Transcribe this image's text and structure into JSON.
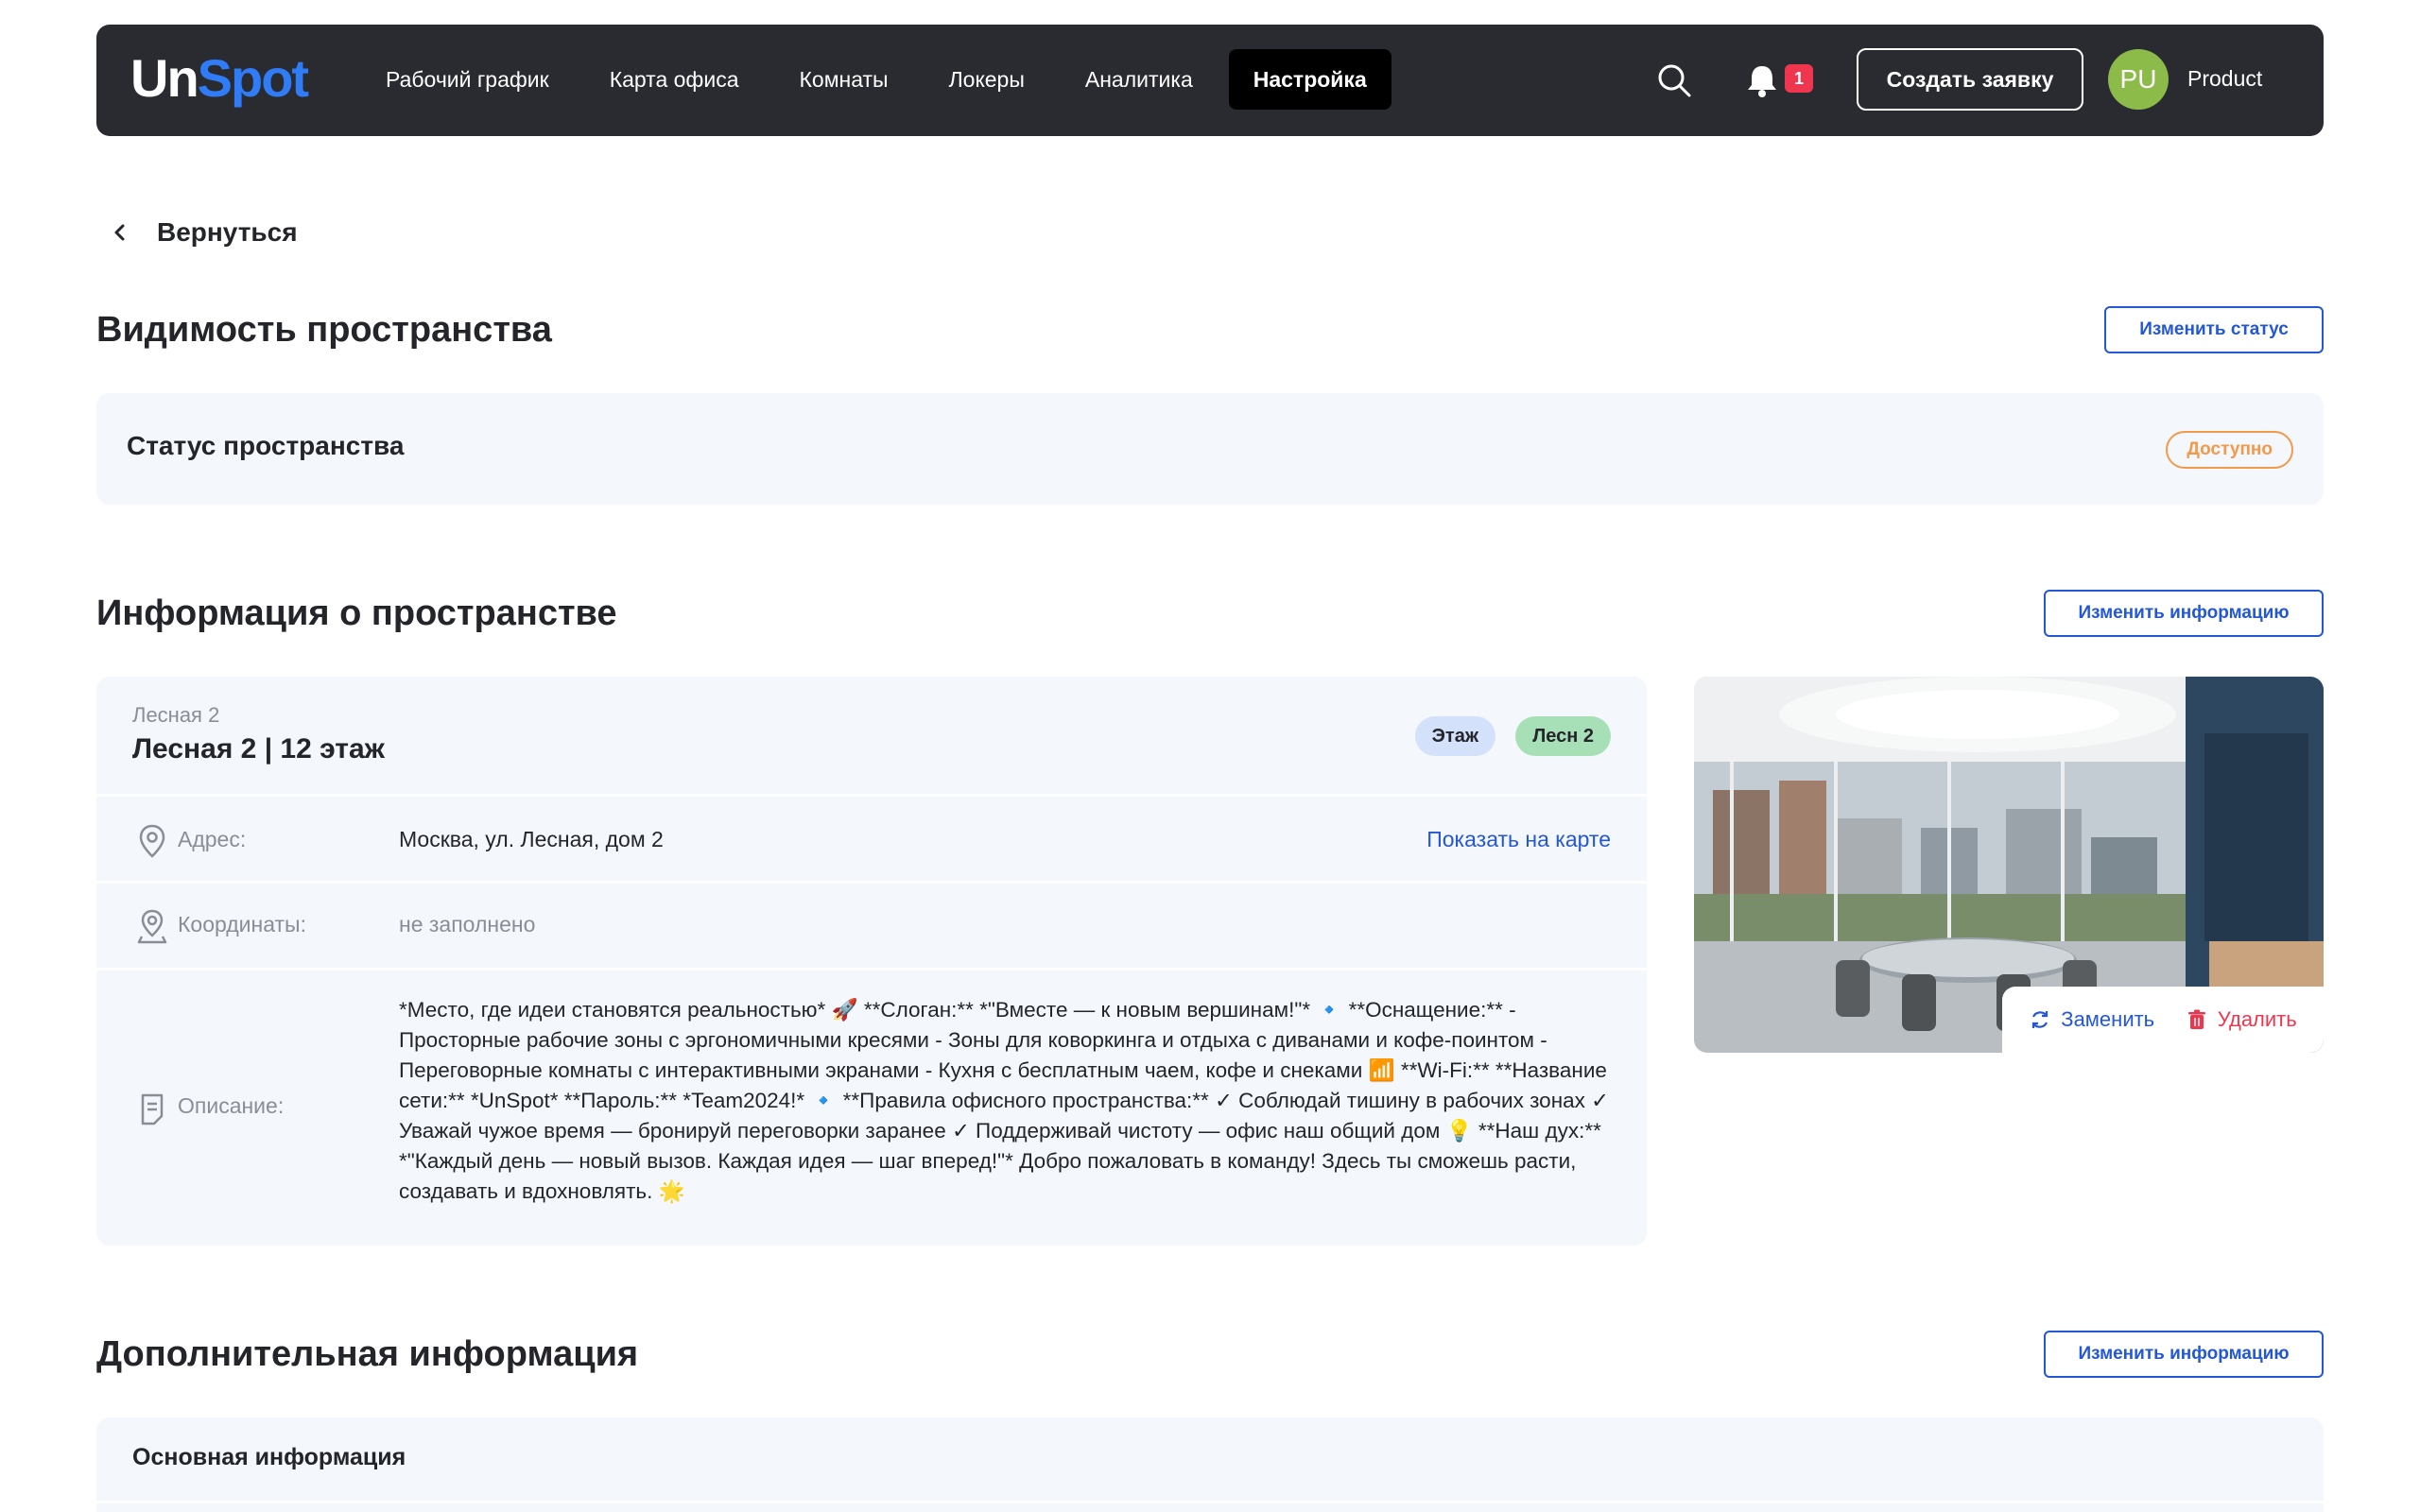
{
  "header": {
    "logo_un": "Un",
    "logo_spot": "Spot",
    "nav": [
      "Рабочий график",
      "Карта офиса",
      "Комнаты",
      "Локеры",
      "Аналитика",
      "Настройка"
    ],
    "active_nav": "Настройка",
    "notification_count": "1",
    "create_button": "Создать заявку",
    "avatar_initials": "PU",
    "user_name": "Product",
    "avatar_color": "#8dbb4a",
    "accent_color": "#2f7cf6"
  },
  "back": {
    "label": "Вернуться"
  },
  "visibility": {
    "title": "Видимость пространства",
    "change_button": "Изменить статус",
    "status_label": "Статус пространства",
    "status_value": "Доступно",
    "status_color": "#f39a4a"
  },
  "info": {
    "title": "Информация о пространстве",
    "change_button": "Изменить информацию",
    "building": "Лесная 2",
    "space_name": "Лесная 2 | 12 этаж",
    "tags": [
      "Этаж",
      "Лесн 2"
    ],
    "address_label": "Адрес:",
    "address_value": "Москва, ул. Лесная, дом 2",
    "map_link": "Показать на карте",
    "coords_label": "Координаты:",
    "coords_value": "не заполнено",
    "desc_label": "Описание:",
    "desc_value": "*Место, где идеи становятся реальностью* 🚀 **Слоган:** *\"Вместе — к новым вершинам!\"* 🔹 **Оснащение:** - Просторные рабочие зоны с эргономичными кресями - Зоны для коворкинга и отдыха с диванами и кофе-поинтом - Переговорные комнаты с интерактивными экранами - Кухня с бесплатным чаем, кофе и снеками 📶 **Wi-Fi:** **Название сети:** *UnSpot* **Пароль:** *Team2024!* 🔹 **Правила офисного пространства:** ✓ Соблюдай тишину в рабочих зонах ✓ Уважай чужое время — бронируй переговорки заранее ✓ Поддерживай чистоту — офис наш общий дом 💡 **Наш дух:** *\"Каждый день — новый вызов. Каждая идея — шаг вперед!\"* Добро пожаловать в команду! Здесь ты сможешь расти, создавать и вдохновлять. 🌟",
    "photo_replace": "Заменить",
    "photo_delete": "Удалить"
  },
  "extra": {
    "title": "Дополнительная информация",
    "change_button": "Изменить информацию",
    "subsection": "Основная информация"
  }
}
